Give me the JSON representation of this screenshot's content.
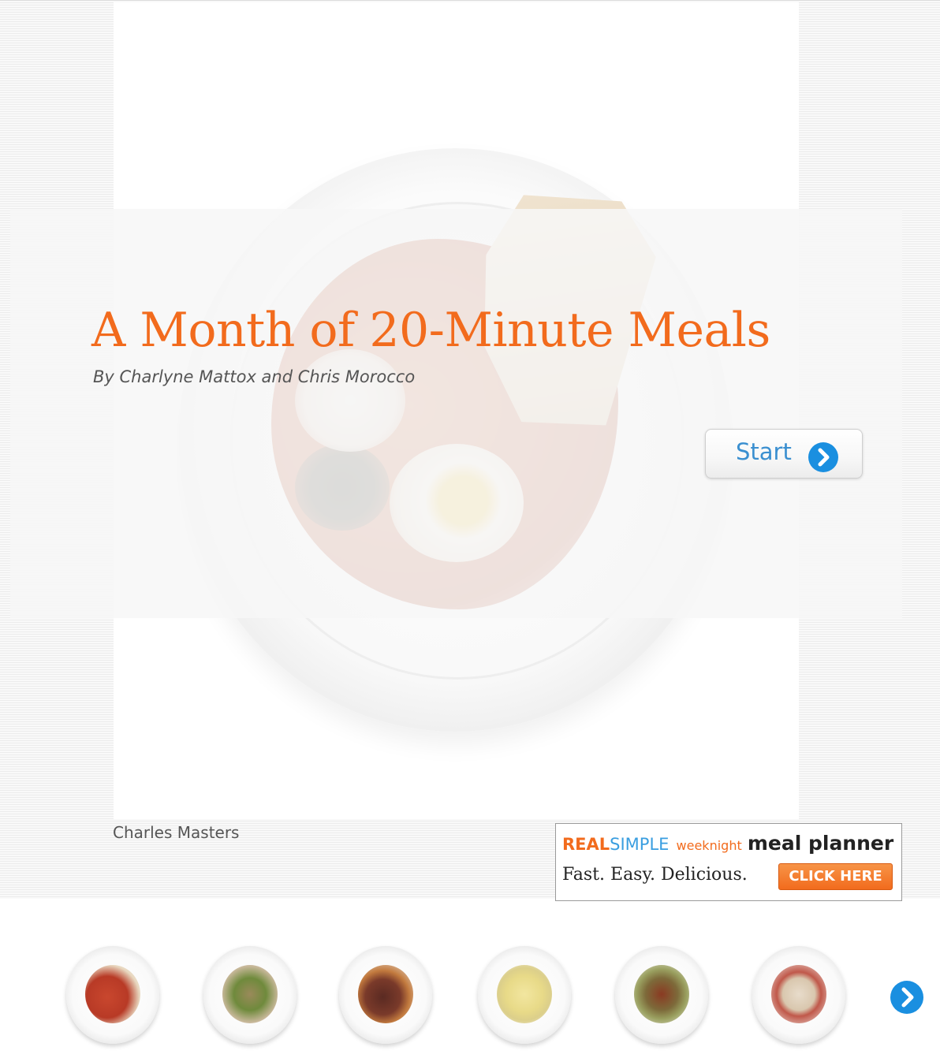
{
  "hero": {
    "title": "A Month of 20-Minute Meals",
    "byline": "By Charlyne Mattox and Chris Morocco",
    "start_label": "Start",
    "photo_credit": "Charles Masters"
  },
  "ad": {
    "brand_real": "REAL",
    "brand_simple": "SIMPLE",
    "weeknight": "weeknight",
    "planner": "meal planner",
    "tagline": "Fast. Easy. Delicious.",
    "cta": "CLICK HERE"
  },
  "colors": {
    "accent_orange": "#f26b1d",
    "accent_blue": "#3a8fd0"
  },
  "thumbnails": [
    {
      "icon": "shakshuka-plate-thumbnail"
    },
    {
      "icon": "salad-plate-thumbnail"
    },
    {
      "icon": "steak-carrots-plate-thumbnail"
    },
    {
      "icon": "egg-soup-plate-thumbnail"
    },
    {
      "icon": "chicken-greens-plate-thumbnail"
    },
    {
      "icon": "pasta-plate-thumbnail"
    }
  ]
}
